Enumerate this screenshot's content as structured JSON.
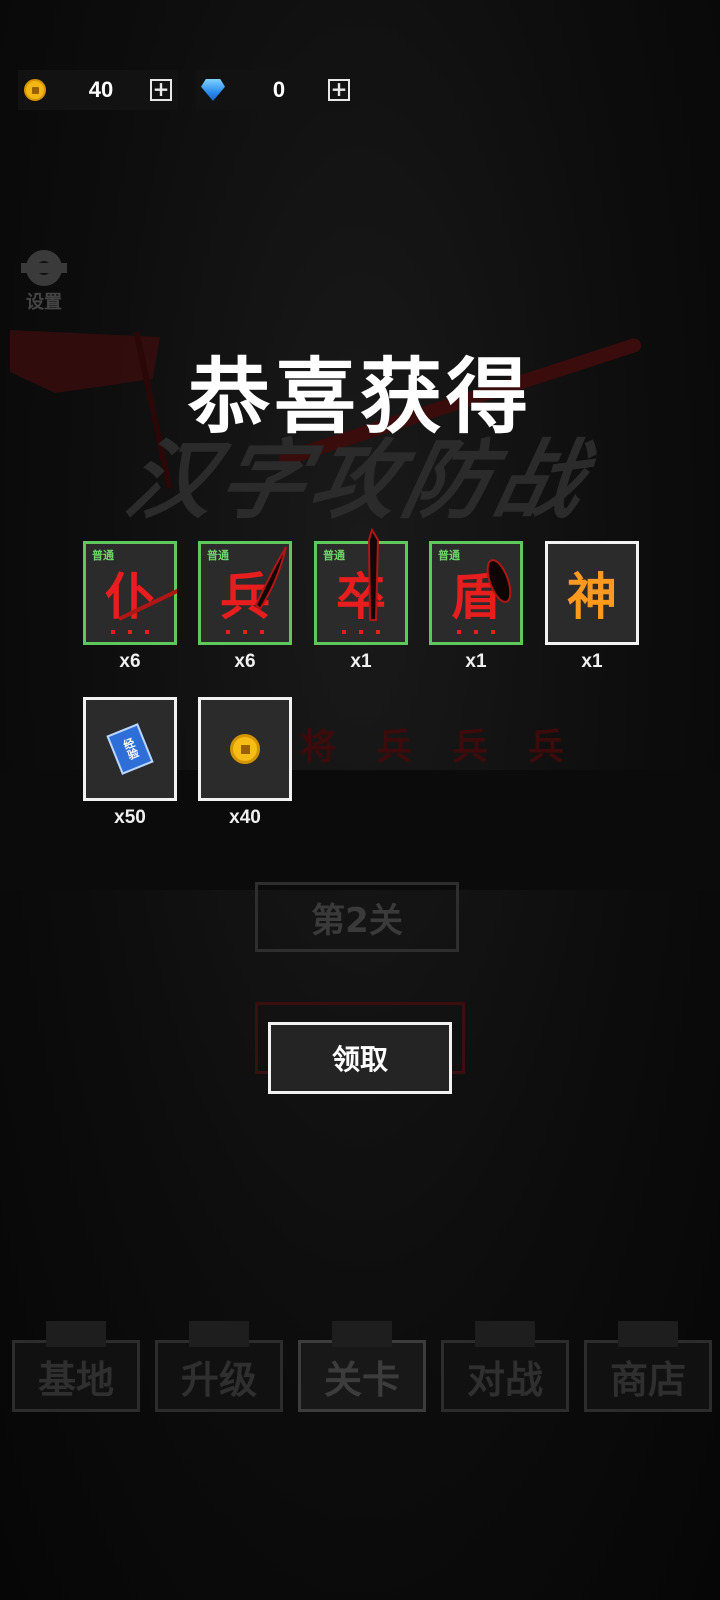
{
  "currency": {
    "gold": {
      "icon": "coin-icon",
      "value": "40"
    },
    "gems": {
      "icon": "diamond-icon",
      "value": "0"
    }
  },
  "settings": {
    "label": "设置",
    "icon": "gear-icon"
  },
  "background": {
    "game_title": "汉字攻防战",
    "soldiers": [
      "将",
      "兵",
      "兵",
      "兵"
    ],
    "stage_label": "第2关"
  },
  "dialog": {
    "title": "恭喜获得",
    "claim_label": "领取",
    "rewards": [
      {
        "glyph": "仆",
        "rarity": "普通",
        "count": "x6",
        "weapon": "spear"
      },
      {
        "glyph": "兵",
        "rarity": "普通",
        "count": "x6",
        "weapon": "sword"
      },
      {
        "glyph": "卒",
        "rarity": "普通",
        "count": "x1",
        "weapon": "blade"
      },
      {
        "glyph": "盾",
        "rarity": "普通",
        "count": "x1",
        "weapon": "shield"
      },
      {
        "glyph": "神",
        "rarity": "",
        "count": "x1",
        "weapon": ""
      },
      {
        "glyph": "经验",
        "rarity": "",
        "count": "x50",
        "icon": "exp-book-icon"
      },
      {
        "glyph": "",
        "rarity": "",
        "count": "x40",
        "icon": "coin-icon"
      }
    ]
  },
  "nav": [
    {
      "label": "基地"
    },
    {
      "label": "升级"
    },
    {
      "label": "关卡"
    },
    {
      "label": "对战"
    },
    {
      "label": "商店"
    }
  ]
}
